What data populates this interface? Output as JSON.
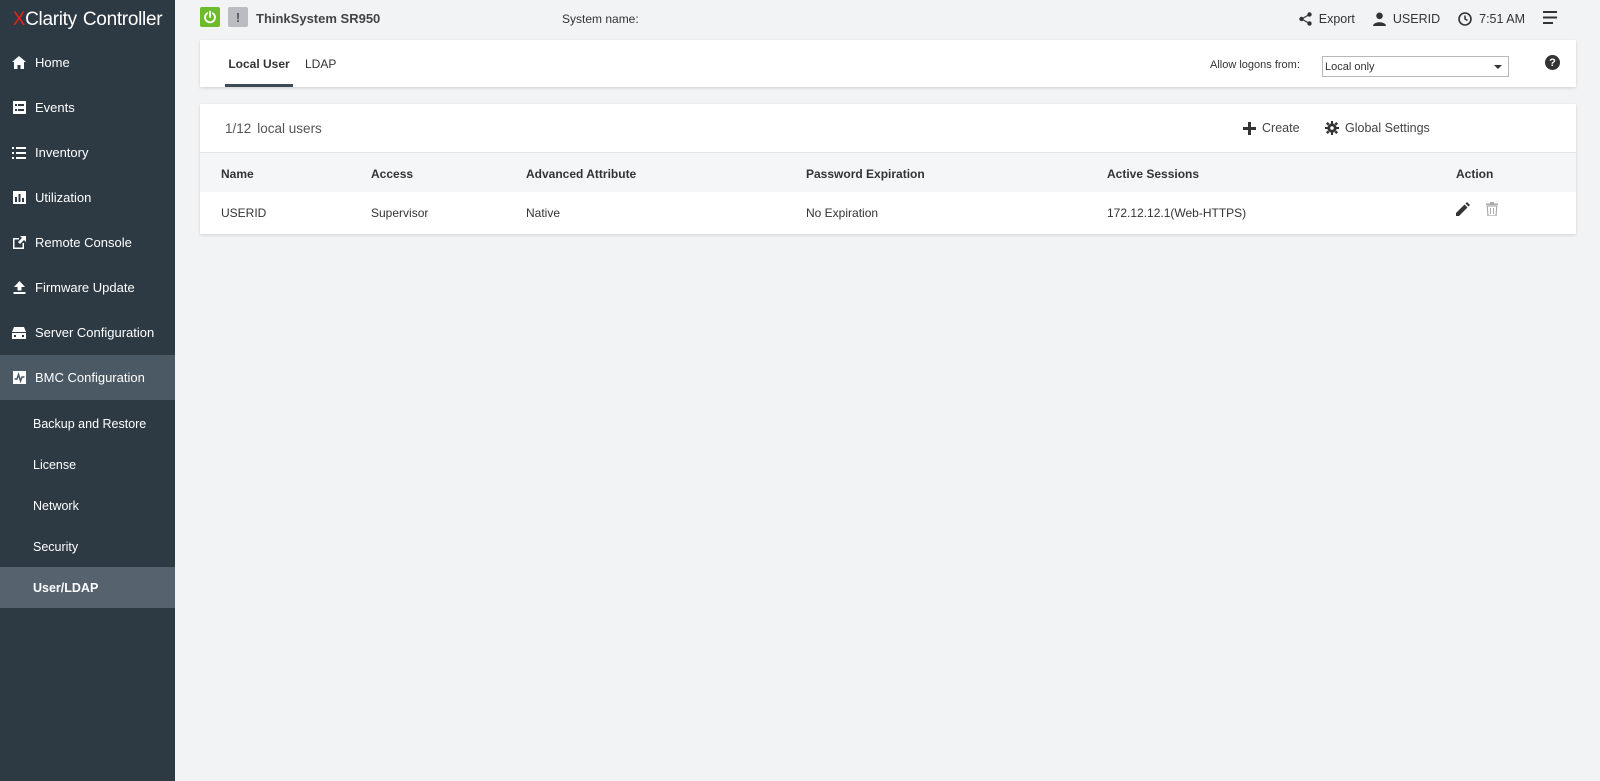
{
  "app": {
    "logo_x": "X",
    "logo_clarity": "Clarity",
    "logo_controller": "Controller",
    "system_model": "ThinkSystem SR950",
    "system_name_label": "System name:"
  },
  "topbar": {
    "export_label": "Export",
    "user_label": "USERID",
    "time_label": "7:51 AM",
    "warn_glyph": "!"
  },
  "sidebar": {
    "items": [
      {
        "label": "Home",
        "icon": "home-icon"
      },
      {
        "label": "Events",
        "icon": "events-icon"
      },
      {
        "label": "Inventory",
        "icon": "list-icon"
      },
      {
        "label": "Utilization",
        "icon": "chart-icon"
      },
      {
        "label": "Remote Console",
        "icon": "external-link-icon"
      },
      {
        "label": "Firmware Update",
        "icon": "upload-icon"
      },
      {
        "label": "Server Configuration",
        "icon": "server-icon"
      },
      {
        "label": "BMC Configuration",
        "icon": "pulse-icon"
      }
    ],
    "sub_items": [
      {
        "label": "Backup and Restore"
      },
      {
        "label": "License"
      },
      {
        "label": "Network"
      },
      {
        "label": "Security"
      },
      {
        "label": "User/LDAP"
      }
    ]
  },
  "tabs": {
    "local_user": "Local User",
    "ldap": "LDAP",
    "allow_label": "Allow logons from:",
    "allow_value": "Local only",
    "help_glyph": "?"
  },
  "users": {
    "count": "1/12",
    "count_suffix": "local users",
    "create_label": "Create",
    "global_settings_label": "Global Settings",
    "columns": [
      "Name",
      "Access",
      "Advanced Attribute",
      "Password Expiration",
      "Active Sessions",
      "Action"
    ],
    "rows": [
      [
        "USERID",
        "Supervisor",
        "Native",
        "No Expiration",
        "172.12.12.1(Web-HTTPS)"
      ]
    ]
  }
}
